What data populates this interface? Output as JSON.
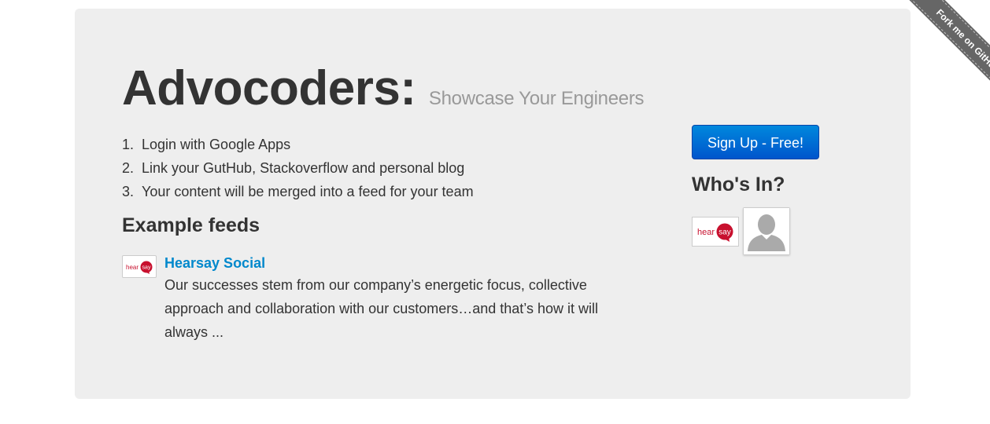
{
  "hero": {
    "title": "Advocoders:",
    "subtitle": "Showcase Your Engineers"
  },
  "steps": [
    {
      "num": "1.",
      "text": "Login with Google Apps"
    },
    {
      "num": "2.",
      "text": "Link your GutHub, Stackoverflow and personal blog"
    },
    {
      "num": "3.",
      "text": "Your content will be merged into a feed for your team"
    }
  ],
  "examples": {
    "heading": "Example feeds",
    "feeds": [
      {
        "logo_text_a": "hear",
        "logo_text_b": "say",
        "name": "Hearsay Social",
        "excerpt": "Our successes stem from our company’s energetic focus, collective approach and collaboration with our customers…and that’s how it will always ..."
      }
    ]
  },
  "signup": {
    "label": "Sign Up - Free!"
  },
  "whos_in": {
    "heading": "Who's In?",
    "members": [
      {
        "type": "logo",
        "text_a": "hear",
        "text_b": "say"
      },
      {
        "type": "avatar",
        "icon": "person-icon"
      }
    ]
  },
  "ribbon": {
    "label": "Fork me on GitHub"
  },
  "colors": {
    "hero_bg": "#eeeeee",
    "link": "#0088cc",
    "button": "#0066cc",
    "brand_red": "#c8102e",
    "ribbon": "#666666"
  }
}
